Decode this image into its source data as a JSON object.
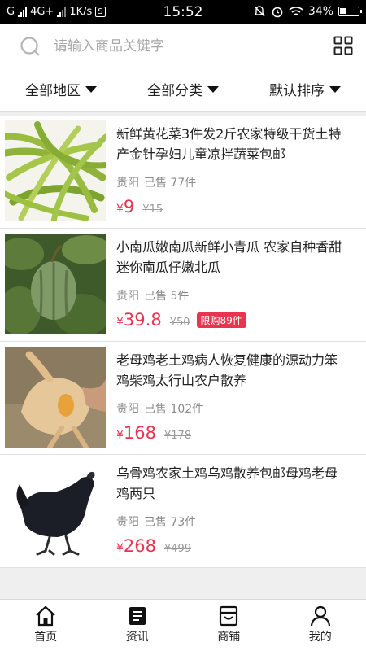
{
  "status_bar": {
    "carrier": "G",
    "network": "4G+",
    "speed": "1K/s",
    "time": "15:52",
    "battery": "34%"
  },
  "search": {
    "placeholder": "请输入商品关键字"
  },
  "filters": [
    {
      "label": "全部地区"
    },
    {
      "label": "全部分类"
    },
    {
      "label": "默认排序"
    }
  ],
  "products": [
    {
      "title": "新鲜黄花菜3件发2斤农家特级干货土特产金针孕妇儿童凉拌蔬菜包邮",
      "location": "贵阳",
      "sold": "已售 77件",
      "currency": "¥",
      "price": "9",
      "old_price": "¥15",
      "tag": "",
      "image": "daylily-image"
    },
    {
      "title": "小南瓜嫩南瓜新鲜小青瓜 农家自种香甜迷你南瓜仔嫩北瓜",
      "location": "贵阳",
      "sold": "已售 5件",
      "currency": "¥",
      "price": "39.8",
      "old_price": "¥50",
      "tag": "限购89件",
      "image": "pumpkin-image"
    },
    {
      "title": "老母鸡老土鸡病人恢复健康的源动力笨鸡柴鸡太行山农户散养",
      "location": "贵阳",
      "sold": "已售 102件",
      "currency": "¥",
      "price": "168",
      "old_price": "¥178",
      "tag": "",
      "image": "hen-image"
    },
    {
      "title": "乌骨鸡农家土鸡乌鸡散养包邮母鸡老母鸡两只",
      "location": "贵阳",
      "sold": "已售 73件",
      "currency": "¥",
      "price": "268",
      "old_price": "¥499",
      "tag": "",
      "image": "black-chicken-image"
    }
  ],
  "tabs": [
    {
      "label": "首页",
      "icon": "home-icon"
    },
    {
      "label": "资讯",
      "icon": "news-icon"
    },
    {
      "label": "商铺",
      "icon": "shop-icon"
    },
    {
      "label": "我的",
      "icon": "user-icon"
    }
  ],
  "colors": {
    "accent": "#e8344e",
    "background": "#efefef"
  }
}
